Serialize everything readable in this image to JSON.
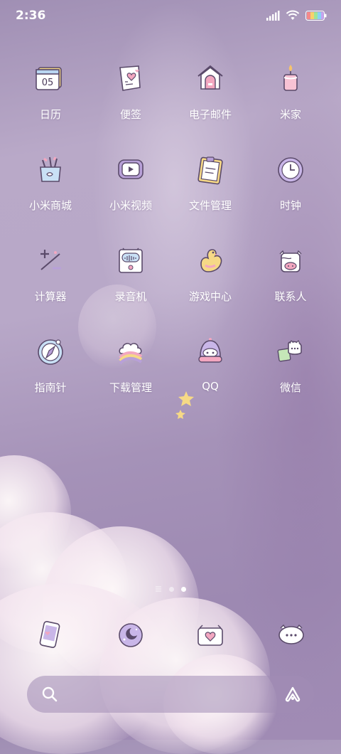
{
  "status_bar": {
    "time": "2:36"
  },
  "apps": [
    {
      "label": "日历",
      "icon": "calendar-icon",
      "date": "05"
    },
    {
      "label": "便签",
      "icon": "notes-icon"
    },
    {
      "label": "电子邮件",
      "icon": "email-icon"
    },
    {
      "label": "米家",
      "icon": "mijia-icon"
    },
    {
      "label": "小米商城",
      "icon": "mi-store-icon"
    },
    {
      "label": "小米视频",
      "icon": "mi-video-icon"
    },
    {
      "label": "文件管理",
      "icon": "file-manager-icon"
    },
    {
      "label": "时钟",
      "icon": "clock-icon"
    },
    {
      "label": "计算器",
      "icon": "calculator-icon"
    },
    {
      "label": "录音机",
      "icon": "recorder-icon"
    },
    {
      "label": "游戏中心",
      "icon": "game-center-icon"
    },
    {
      "label": "联系人",
      "icon": "contacts-icon"
    },
    {
      "label": "指南针",
      "icon": "compass-icon"
    },
    {
      "label": "下载管理",
      "icon": "downloads-icon"
    },
    {
      "label": "QQ",
      "icon": "qq-icon"
    },
    {
      "label": "微信",
      "icon": "wechat-icon"
    }
  ],
  "page_indicator": {
    "pages": 2,
    "active": 2
  },
  "dock": [
    {
      "icon": "phone-icon"
    },
    {
      "icon": "browser-moon-icon"
    },
    {
      "icon": "camera-heart-icon"
    },
    {
      "icon": "messages-cow-icon"
    }
  ],
  "colors": {
    "accent_purple": "#b8a0d8",
    "label_white": "#ffffff"
  }
}
